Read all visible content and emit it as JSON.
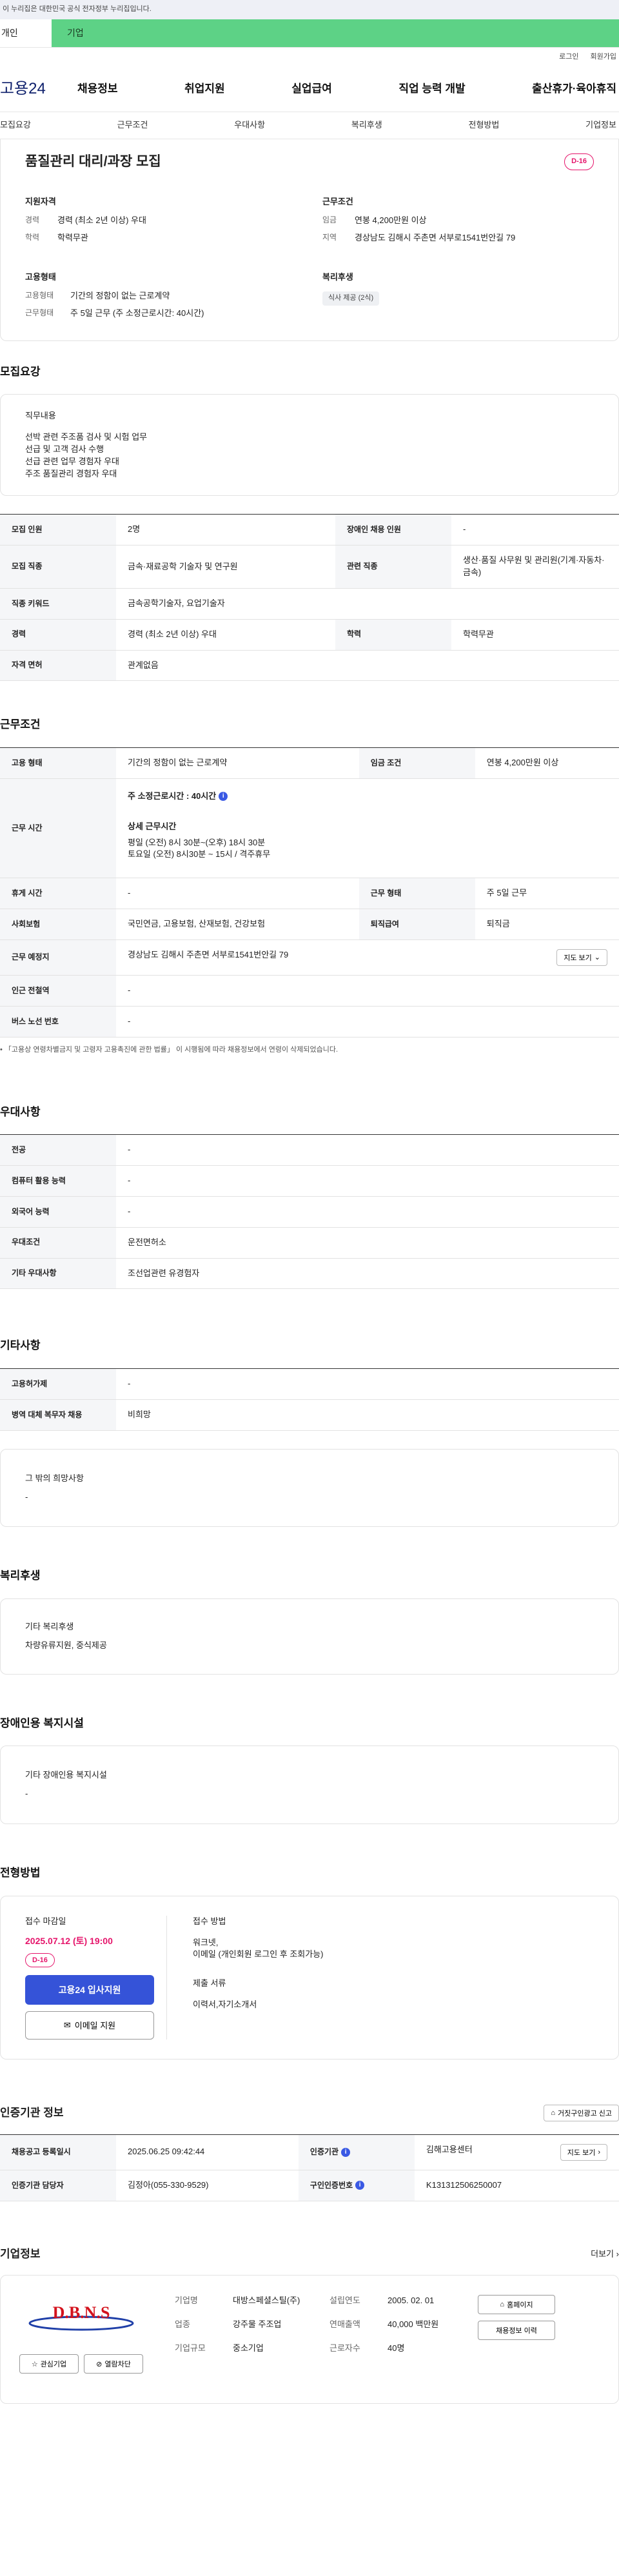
{
  "gov_banner": "이 누리집은 대한민국 공식 전자정부 누리집입니다.",
  "category_tabs": {
    "person": "개인",
    "company": "기업"
  },
  "util": {
    "login": "로그인",
    "join": "회원가입"
  },
  "logo": "고용24",
  "gnb": [
    "채용정보",
    "취업지원",
    "실업급여",
    "직업 능력 개발",
    "출산휴가·육아휴직"
  ],
  "anchor_tabs": [
    "모집요강",
    "근무조건",
    "우대사항",
    "복리후생",
    "전형방법",
    "기업정보"
  ],
  "summary": {
    "title": "품질관리 대리/과장 모집",
    "dday": "D-16",
    "qual_heading": "지원자격",
    "qual": [
      {
        "k": "경력",
        "v": "경력 (최소 2년 이상) 우대"
      },
      {
        "k": "학력",
        "v": "학력무관"
      }
    ],
    "work_heading": "근무조건",
    "work": [
      {
        "k": "임금",
        "v": "연봉 4,200만원 이상"
      },
      {
        "k": "지역",
        "v": "경상남도 김해시 주촌면 서부로1541번안길 79"
      }
    ],
    "emp_heading": "고용형태",
    "emp": [
      {
        "k": "고용형태",
        "v": "기간의 정함이 없는 근로계약"
      },
      {
        "k": "근무형태",
        "v": "주 5일 근무 (주 소정근로시간: 40시간)"
      }
    ],
    "welfare_heading": "복리후생",
    "welfare_tag": "식사 제공 (2식)"
  },
  "recruit": {
    "heading": "모집요강",
    "duty_label": "직무내용",
    "duty_lines": [
      "선박 관련 주조품 검사 및 시험 업무",
      "선급 및 고객 검사 수행",
      "선급 관련 업무 경험자 우대",
      "주조 품질관리 경험자 우대"
    ],
    "headcount_l": "모집 인원",
    "headcount": "2명",
    "disabled_l": "장애인 채용 인원",
    "disabled": "-",
    "job_l": "모집 직종",
    "job": "금속·재료공학 기술자 및 연구원",
    "related_l": "관련 직종",
    "related": "생산·품질 사무원 및 관리원(기계·자동차·금속)",
    "keyword_l": "직종 키워드",
    "keyword": "금속공학기술자, 요업기술자",
    "career_l": "경력",
    "career": "경력 (최소 2년 이상) 우대",
    "edu_l": "학력",
    "edu": "학력무관",
    "license_l": "자격 면허",
    "license": "관계없음"
  },
  "work": {
    "heading": "근무조건",
    "emptype_l": "고용 형태",
    "emptype": "기간의 정함이 없는 근로계약",
    "wage_l": "임금 조건",
    "wage": "연봉 4,200만원 이상",
    "hours_l": "근무 시간",
    "hours_main": "주 소정근로시간 : 40시간",
    "hours_detail_l": "상세 근무시간",
    "hours_weekday": "평일 (오전) 8시 30분~(오후) 18시 30분",
    "hours_sat": "토요일 (오전) 8시30분 ~ 15시 / 격주휴무",
    "holiday_l": "휴게 시간",
    "holiday": "-",
    "form_l": "근무 형태",
    "form": "주 5일 근무",
    "insurance_l": "사회보험",
    "insurance": "국민연금, 고용보험, 산재보험, 건강보험",
    "retire_l": "퇴직급여",
    "retire": "퇴직금",
    "place_l": "근무 예정지",
    "place": "경상남도 김해시 주촌면 서부로1541번안길 79",
    "map_btn": "지도 보기",
    "subway_l": "인근 전철역",
    "subway": "-",
    "bus_l": "버스 노선 번호",
    "bus": "-",
    "note": "「고용상 연령차별금지 및 고령자 고용촉진에 관한 법률」 이 시행됨에 따라 채용정보에서 연령이 삭제되었습니다."
  },
  "pref": {
    "heading": "우대사항",
    "rows": [
      {
        "k": "전공",
        "v": "-"
      },
      {
        "k": "컴퓨터 활용 능력",
        "v": "-"
      },
      {
        "k": "외국어 능력",
        "v": "-"
      },
      {
        "k": "우대조건",
        "v": "운전면허소"
      },
      {
        "k": "기타 우대사항",
        "v": "조선업관련 유경험자"
      }
    ]
  },
  "etc": {
    "heading": "기타사항",
    "rows": [
      {
        "k": "고용허가제",
        "v": "-"
      },
      {
        "k": "병역 대체 복무자 채용",
        "v": "비희망"
      }
    ],
    "extra_label": "그 밖의 희망사항",
    "extra": "-"
  },
  "benefit": {
    "heading": "복리후생",
    "label": "기타 복리후생",
    "value": "차량유류지원, 중식제공"
  },
  "facility": {
    "heading": "장애인용 복지시설",
    "label": "기타 장애인용 복지시설",
    "value": "-"
  },
  "method": {
    "heading": "전형방법",
    "deadline_l": "접수 마감일",
    "deadline": "2025.07.12 (토) 19:00",
    "dday": "D-16",
    "apply_btn": "고용24 입사지원",
    "email_btn": "이메일 지원",
    "how_l": "접수 방법",
    "how1": "워크넷,",
    "how2": "이메일 (개인회원 로그인 후 조회가능)",
    "docs_l": "제출 서류",
    "docs": "이력서,자기소개서"
  },
  "cert": {
    "heading": "인증기관 정보",
    "report_btn": "거짓구인광고 신고",
    "reg_l": "채용공고 등록일시",
    "reg": "2025.06.25 09:42:44",
    "agency_l": "인증기관",
    "agency": "김해고용센터",
    "map_btn": "지도 보기",
    "mgr_l": "인증기관 담당자",
    "mgr": "김정아(055-330-9529)",
    "no_l": "구인인증번호",
    "no": "K131312506250007"
  },
  "company": {
    "heading": "기업정보",
    "more": "더보기",
    "logo_text": "D.B.N.S",
    "fav_btn": "관심기업",
    "block_btn": "열람차단",
    "name_l": "기업명",
    "name": "대방스페셜스틸(주)",
    "industry_l": "업종",
    "industry": "강주물 주조업",
    "scale_l": "기업규모",
    "scale": "중소기업",
    "year_l": "설립연도",
    "year": "2005. 02. 01",
    "sales_l": "연매출액",
    "sales": "40,000 백만원",
    "staff_l": "근로자수",
    "staff": "40명",
    "home_btn": "홈페이지",
    "jobs_btn": "채용정보 이력"
  }
}
